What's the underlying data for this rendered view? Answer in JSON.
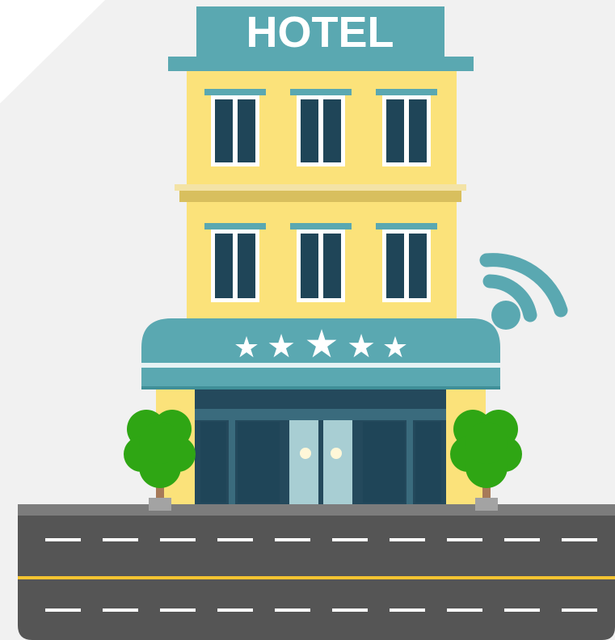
{
  "sign": {
    "text": "HOTEL"
  },
  "rating": {
    "stars": 5,
    "glyph": "★"
  },
  "icons": {
    "wifi": "wifi-icon"
  },
  "colors": {
    "background_panel": "#f1f1f1",
    "building_wall": "#fbe27a",
    "teal": "#5aa8b1",
    "teal_dark": "#3f8f98",
    "window_frame": "#ffffff",
    "window_glass": "#1f4558",
    "ledge": "#d8bf5e",
    "door_glass": "#a8ced3",
    "storefront": "#24495c",
    "tree_green": "#2fa614",
    "tree_trunk": "#a77a59",
    "road": "#555555",
    "curb": "#7c7c7c",
    "lane_white": "#ffffff",
    "lane_yellow": "#f6c431"
  }
}
